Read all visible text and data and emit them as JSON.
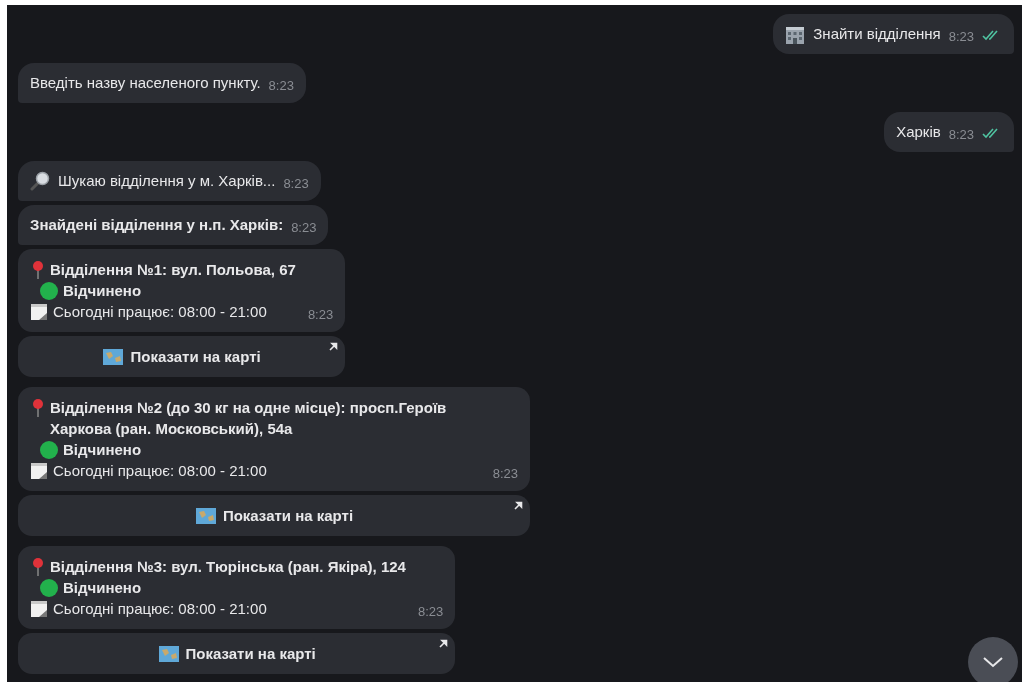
{
  "messages": [
    {
      "kind": "command",
      "text": "Знайти відділення",
      "time": "8:23",
      "read": true
    },
    {
      "kind": "incoming",
      "text": "Введіть назву населеного пункту.",
      "time": "8:23",
      "bold": false
    },
    {
      "kind": "outgoing",
      "text": "Харків",
      "time": "8:23",
      "read": true
    },
    {
      "kind": "search",
      "text": "Шукаю відділення у м. Харків...",
      "time": "8:23",
      "bold": false
    },
    {
      "kind": "incoming",
      "text": "Знайдені відділення у н.п. Харків:",
      "time": "8:23",
      "bold": true
    },
    {
      "kind": "card",
      "title": "Відділення №1: вул. Польова, 67",
      "status": "Відчинено",
      "hours": "Сьогодні працює: 08:00 - 21:00",
      "time": "8:23",
      "button": "Показати на карті"
    },
    {
      "kind": "card",
      "title": "Відділення №2 (до 30 кг на одне місце): просп.Героїв Харкова (ран. Московський), 54а",
      "status": "Відчинено",
      "hours": "Сьогодні працює: 08:00 - 21:00",
      "time": "8:23",
      "button": "Показати на карті"
    },
    {
      "kind": "card",
      "title": "Відділення №3: вул. Тюрінська (ран. Якіра), 124",
      "status": "Відчинено",
      "hours": "Сьогодні працює: 08:00 - 21:00",
      "time": "8:23",
      "button": "Показати на карті"
    }
  ]
}
